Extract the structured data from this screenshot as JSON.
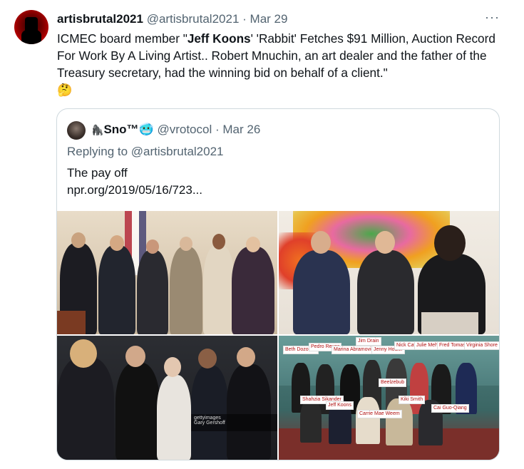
{
  "tweet": {
    "display_name": "artisbrutal2021",
    "handle": "@artisbrutal2021",
    "separator": "·",
    "date": "Mar 29",
    "more_label": "···",
    "text_part1": "ICMEC board member \"",
    "text_bold": "Jeff Koons",
    "text_part2": "' 'Rabbit' Fetches $91 Million, Auction Record For Work By A Living Artist.. Robert Mnuchin, an art dealer and the father of the Treasury secretary, had the winning bid on behalf of a client.\"",
    "emoji": "🤔"
  },
  "quote": {
    "display_name_prefix": "🦍",
    "display_name": "Sno™",
    "display_name_suffix": "🥶",
    "handle": "@vrotocol",
    "separator": "·",
    "date": "Mar 26",
    "reply_to": "Replying to @artisbrutal2021",
    "text_line1": "The pay off",
    "text_line2": "npr.org/2019/05/16/723..."
  },
  "photo4_labels": [
    "Beth Dozoretz",
    "Pedro Reyes",
    "Marina Abramovic",
    "Jim Drain",
    "Jenny Holzer",
    "Nick Cave",
    "Julie Mehretu",
    "Fred Tomaselli",
    "Virginia Shore",
    "Beelzebub",
    "Shahzia Sikander",
    "Jeff Koons",
    "Carrie Mae Weem",
    "Kiki Smith",
    "Cai Guo-Qiang"
  ],
  "photo3_watermark": "gettyimages",
  "photo3_credit": "Gary Gershoff"
}
